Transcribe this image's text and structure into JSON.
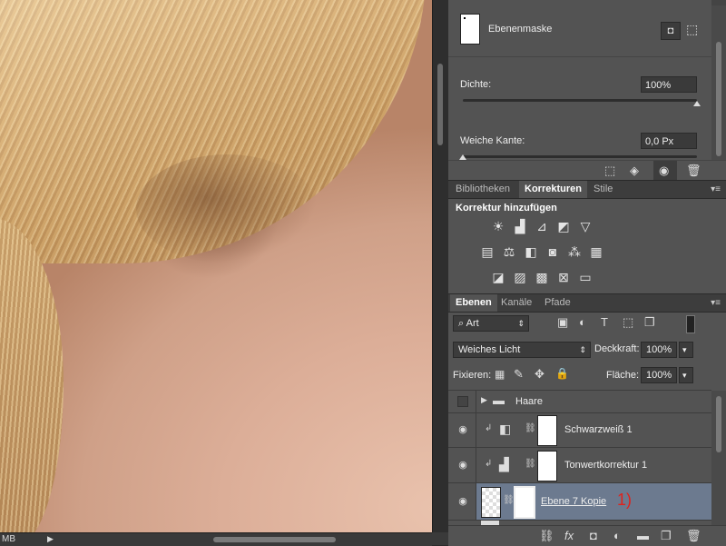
{
  "canvas": {
    "status_label": "MB",
    "scroll_arrow": "▶"
  },
  "properties": {
    "mask_title": "Ebenenmaske",
    "density_label": "Dichte:",
    "density_value": "100%",
    "density_level": 1.0,
    "feather_label": "Weiche Kante:",
    "feather_value": "0,0 Px",
    "feather_level": 0.0,
    "footer_icons": [
      "selection-icon",
      "apply-mask-icon",
      "visibility-icon",
      "trash-icon"
    ]
  },
  "top_tabs": {
    "items": [
      "Bibliotheken",
      "Korrekturen",
      "Stile"
    ],
    "active": "Korrekturen",
    "menu_glyph": "▾≡"
  },
  "adjustments": {
    "title": "Korrektur hinzufügen",
    "row1": [
      "brightness-contrast-icon",
      "levels-icon",
      "curves-icon",
      "exposure-icon",
      "gradient-triangle-icon"
    ],
    "row2": [
      "vibrance-icon",
      "color-balance-icon",
      "black-white-icon",
      "photo-filter-icon",
      "channel-mixer-icon",
      "color-lookup-icon"
    ],
    "row3": [
      "invert-icon",
      "posterize-icon",
      "threshold-icon",
      "selective-color-icon",
      "gradient-map-icon"
    ]
  },
  "layer_tabs": {
    "items": [
      "Ebenen",
      "Kanäle",
      "Pfade"
    ],
    "active": "Ebenen",
    "menu_glyph": "▾≡"
  },
  "layers_panel": {
    "filter_kind": "Art",
    "blend_mode": "Weiches Licht",
    "opacity_label": "Deckkraft:",
    "opacity_value": "100%",
    "lock_label": "Fixieren:",
    "fill_label": "Fläche:",
    "fill_value": "100%",
    "layers": [
      {
        "name": "Haare",
        "type": "group",
        "visible": false
      },
      {
        "name": "Schwarzweiß 1",
        "type": "adjustment",
        "visible": true
      },
      {
        "name": "Tonwertkorrektur 1",
        "type": "adjustment",
        "visible": true
      },
      {
        "name": "Ebene 7 Kopie",
        "type": "pixel",
        "visible": true,
        "selected": true,
        "annotation": "1)"
      }
    ],
    "footer_icons": [
      "link-icon",
      "fx-icon",
      "mask-icon",
      "adjustment-icon",
      "folder-icon",
      "new-layer-icon",
      "trash-icon"
    ]
  },
  "colors": {
    "panel_bg": "#535353",
    "selected_row": "#6c7a8f",
    "annotation_red": "#e0221c"
  }
}
